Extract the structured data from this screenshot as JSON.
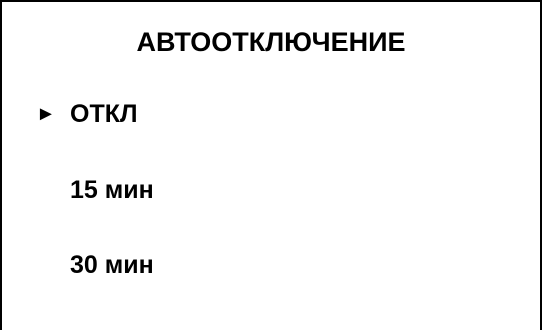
{
  "screen": {
    "title": "АВТООТКЛЮЧЕНИЕ",
    "selection_marker": "►",
    "items": [
      {
        "label": "ОТКЛ",
        "selected": true
      },
      {
        "label": "15 мин",
        "selected": false
      },
      {
        "label": "30 мин",
        "selected": false
      }
    ]
  }
}
